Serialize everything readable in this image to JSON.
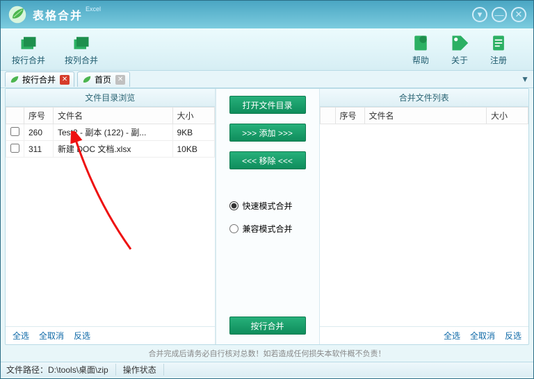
{
  "app": {
    "title": "表格合并",
    "subtitle": "Excel"
  },
  "toolbar": {
    "merge_rows": "按行合并",
    "merge_cols": "按列合并",
    "help": "帮助",
    "about": "关于",
    "register": "注册"
  },
  "tabs": {
    "active": "按行合并",
    "home": "首页"
  },
  "panes": {
    "left_header": "文件目录浏览",
    "right_header": "合并文件列表"
  },
  "cols": {
    "seq": "序号",
    "filename": "文件名",
    "size": "大小"
  },
  "left_rows": [
    {
      "seq": "260",
      "name": "Test2 - 副本 (122) - 副...",
      "size": "9KB"
    },
    {
      "seq": "311",
      "name": "新建 DOC 文档.xlsx",
      "size": "10KB"
    }
  ],
  "middle": {
    "open_dir": "打开文件目录",
    "add": ">>> 添加 >>>",
    "remove": "<<< 移除 <<<",
    "fast": "快速模式合并",
    "compat": "兼容模式合并",
    "do_merge": "按行合并"
  },
  "footer": {
    "select_all": "全选",
    "deselect_all": "全取消",
    "invert": "反选"
  },
  "disclaimer": "合并完成后请务必自行核对总数！如若造成任何损失本软件概不负责！",
  "status": {
    "path_label": "文件路径：",
    "path": "D:\\tools\\桌面\\zip",
    "state": "操作状态"
  }
}
